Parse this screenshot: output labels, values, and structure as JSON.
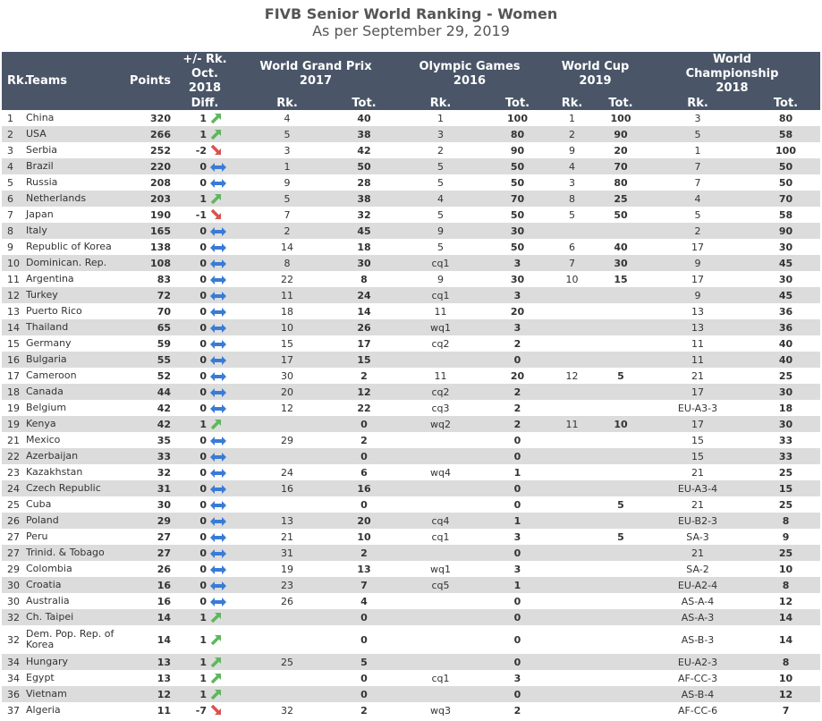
{
  "title": "FIVB Senior World Ranking - Women",
  "subtitle": "As per September 29, 2019",
  "headers": {
    "rk": "Rk.",
    "teams": "Teams",
    "points": "Points",
    "diff_top": "+/- Rk. Oct. 2018",
    "diff_bottom": "Diff.",
    "wgp": "World Grand Prix 2017",
    "og": "Olympic Games 2016",
    "wc": "World Cup 2019",
    "wch": "World Championship 2018",
    "sub_rk": "Rk.",
    "sub_tot": "Tot."
  },
  "colors": {
    "header_bg": "#4a5568",
    "up": "#5cb85c",
    "down": "#d9534f",
    "same": "#3a7bd5"
  },
  "rows": [
    {
      "rk": "1",
      "team": "China",
      "points": "320",
      "diff": "1",
      "trend": "up",
      "gpr": "4",
      "gpt": "40",
      "ogr": "1",
      "ogt": "100",
      "wcr": "1",
      "wct": "100",
      "chr": "3",
      "cht": "80"
    },
    {
      "rk": "2",
      "team": "USA",
      "points": "266",
      "diff": "1",
      "trend": "up",
      "gpr": "5",
      "gpt": "38",
      "ogr": "3",
      "ogt": "80",
      "wcr": "2",
      "wct": "90",
      "chr": "5",
      "cht": "58"
    },
    {
      "rk": "3",
      "team": "Serbia",
      "points": "252",
      "diff": "-2",
      "trend": "down",
      "gpr": "3",
      "gpt": "42",
      "ogr": "2",
      "ogt": "90",
      "wcr": "9",
      "wct": "20",
      "chr": "1",
      "cht": "100"
    },
    {
      "rk": "4",
      "team": "Brazil",
      "points": "220",
      "diff": "0",
      "trend": "same",
      "gpr": "1",
      "gpt": "50",
      "ogr": "5",
      "ogt": "50",
      "wcr": "4",
      "wct": "70",
      "chr": "7",
      "cht": "50"
    },
    {
      "rk": "5",
      "team": "Russia",
      "points": "208",
      "diff": "0",
      "trend": "same",
      "gpr": "9",
      "gpt": "28",
      "ogr": "5",
      "ogt": "50",
      "wcr": "3",
      "wct": "80",
      "chr": "7",
      "cht": "50"
    },
    {
      "rk": "6",
      "team": "Netherlands",
      "points": "203",
      "diff": "1",
      "trend": "up",
      "gpr": "5",
      "gpt": "38",
      "ogr": "4",
      "ogt": "70",
      "wcr": "8",
      "wct": "25",
      "chr": "4",
      "cht": "70"
    },
    {
      "rk": "7",
      "team": "Japan",
      "points": "190",
      "diff": "-1",
      "trend": "down",
      "gpr": "7",
      "gpt": "32",
      "ogr": "5",
      "ogt": "50",
      "wcr": "5",
      "wct": "50",
      "chr": "5",
      "cht": "58"
    },
    {
      "rk": "8",
      "team": "Italy",
      "points": "165",
      "diff": "0",
      "trend": "same",
      "gpr": "2",
      "gpt": "45",
      "ogr": "9",
      "ogt": "30",
      "wcr": "",
      "wct": "",
      "chr": "2",
      "cht": "90"
    },
    {
      "rk": "9",
      "team": "Republic of Korea",
      "points": "138",
      "diff": "0",
      "trend": "same",
      "gpr": "14",
      "gpt": "18",
      "ogr": "5",
      "ogt": "50",
      "wcr": "6",
      "wct": "40",
      "chr": "17",
      "cht": "30"
    },
    {
      "rk": "10",
      "team": "Dominican. Rep.",
      "points": "108",
      "diff": "0",
      "trend": "same",
      "gpr": "8",
      "gpt": "30",
      "ogr": "cq1",
      "ogt": "3",
      "wcr": "7",
      "wct": "30",
      "chr": "9",
      "cht": "45"
    },
    {
      "rk": "11",
      "team": "Argentina",
      "points": "83",
      "diff": "0",
      "trend": "same",
      "gpr": "22",
      "gpt": "8",
      "ogr": "9",
      "ogt": "30",
      "wcr": "10",
      "wct": "15",
      "chr": "17",
      "cht": "30"
    },
    {
      "rk": "12",
      "team": "Turkey",
      "points": "72",
      "diff": "0",
      "trend": "same",
      "gpr": "11",
      "gpt": "24",
      "ogr": "cq1",
      "ogt": "3",
      "wcr": "",
      "wct": "",
      "chr": "9",
      "cht": "45"
    },
    {
      "rk": "13",
      "team": "Puerto Rico",
      "points": "70",
      "diff": "0",
      "trend": "same",
      "gpr": "18",
      "gpt": "14",
      "ogr": "11",
      "ogt": "20",
      "wcr": "",
      "wct": "",
      "chr": "13",
      "cht": "36"
    },
    {
      "rk": "14",
      "team": "Thailand",
      "points": "65",
      "diff": "0",
      "trend": "same",
      "gpr": "10",
      "gpt": "26",
      "ogr": "wq1",
      "ogt": "3",
      "wcr": "",
      "wct": "",
      "chr": "13",
      "cht": "36"
    },
    {
      "rk": "15",
      "team": "Germany",
      "points": "59",
      "diff": "0",
      "trend": "same",
      "gpr": "15",
      "gpt": "17",
      "ogr": "cq2",
      "ogt": "2",
      "wcr": "",
      "wct": "",
      "chr": "11",
      "cht": "40"
    },
    {
      "rk": "16",
      "team": "Bulgaria",
      "points": "55",
      "diff": "0",
      "trend": "same",
      "gpr": "17",
      "gpt": "15",
      "ogr": "",
      "ogt": "0",
      "wcr": "",
      "wct": "",
      "chr": "11",
      "cht": "40"
    },
    {
      "rk": "17",
      "team": "Cameroon",
      "points": "52",
      "diff": "0",
      "trend": "same",
      "gpr": "30",
      "gpt": "2",
      "ogr": "11",
      "ogt": "20",
      "wcr": "12",
      "wct": "5",
      "chr": "21",
      "cht": "25"
    },
    {
      "rk": "18",
      "team": "Canada",
      "points": "44",
      "diff": "0",
      "trend": "same",
      "gpr": "20",
      "gpt": "12",
      "ogr": "cq2",
      "ogt": "2",
      "wcr": "",
      "wct": "",
      "chr": "17",
      "cht": "30"
    },
    {
      "rk": "19",
      "team": "Belgium",
      "points": "42",
      "diff": "0",
      "trend": "same",
      "gpr": "12",
      "gpt": "22",
      "ogr": "cq3",
      "ogt": "2",
      "wcr": "",
      "wct": "",
      "chr": "EU-A3-3",
      "cht": "18"
    },
    {
      "rk": "19",
      "team": "Kenya",
      "points": "42",
      "diff": "1",
      "trend": "up",
      "gpr": "",
      "gpt": "0",
      "ogr": "wq2",
      "ogt": "2",
      "wcr": "11",
      "wct": "10",
      "chr": "17",
      "cht": "30"
    },
    {
      "rk": "21",
      "team": "Mexico",
      "points": "35",
      "diff": "0",
      "trend": "same",
      "gpr": "29",
      "gpt": "2",
      "ogr": "",
      "ogt": "0",
      "wcr": "",
      "wct": "",
      "chr": "15",
      "cht": "33"
    },
    {
      "rk": "22",
      "team": "Azerbaijan",
      "points": "33",
      "diff": "0",
      "trend": "same",
      "gpr": "",
      "gpt": "0",
      "ogr": "",
      "ogt": "0",
      "wcr": "",
      "wct": "",
      "chr": "15",
      "cht": "33"
    },
    {
      "rk": "23",
      "team": "Kazakhstan",
      "points": "32",
      "diff": "0",
      "trend": "same",
      "gpr": "24",
      "gpt": "6",
      "ogr": "wq4",
      "ogt": "1",
      "wcr": "",
      "wct": "",
      "chr": "21",
      "cht": "25"
    },
    {
      "rk": "24",
      "team": "Czech Republic",
      "points": "31",
      "diff": "0",
      "trend": "same",
      "gpr": "16",
      "gpt": "16",
      "ogr": "",
      "ogt": "0",
      "wcr": "",
      "wct": "",
      "chr": "EU-A3-4",
      "cht": "15"
    },
    {
      "rk": "25",
      "team": "Cuba",
      "points": "30",
      "diff": "0",
      "trend": "same",
      "gpr": "",
      "gpt": "0",
      "ogr": "",
      "ogt": "0",
      "wcr": "",
      "wct": "5",
      "chr": "21",
      "cht": "25"
    },
    {
      "rk": "26",
      "team": "Poland",
      "points": "29",
      "diff": "0",
      "trend": "same",
      "gpr": "13",
      "gpt": "20",
      "ogr": "cq4",
      "ogt": "1",
      "wcr": "",
      "wct": "",
      "chr": "EU-B2-3",
      "cht": "8"
    },
    {
      "rk": "27",
      "team": "Peru",
      "points": "27",
      "diff": "0",
      "trend": "same",
      "gpr": "21",
      "gpt": "10",
      "ogr": "cq1",
      "ogt": "3",
      "wcr": "",
      "wct": "5",
      "chr": "SA-3",
      "cht": "9"
    },
    {
      "rk": "27",
      "team": "Trinid. & Tobago",
      "points": "27",
      "diff": "0",
      "trend": "same",
      "gpr": "31",
      "gpt": "2",
      "ogr": "",
      "ogt": "0",
      "wcr": "",
      "wct": "",
      "chr": "21",
      "cht": "25"
    },
    {
      "rk": "29",
      "team": "Colombia",
      "points": "26",
      "diff": "0",
      "trend": "same",
      "gpr": "19",
      "gpt": "13",
      "ogr": "wq1",
      "ogt": "3",
      "wcr": "",
      "wct": "",
      "chr": "SA-2",
      "cht": "10"
    },
    {
      "rk": "30",
      "team": "Croatia",
      "points": "16",
      "diff": "0",
      "trend": "same",
      "gpr": "23",
      "gpt": "7",
      "ogr": "cq5",
      "ogt": "1",
      "wcr": "",
      "wct": "",
      "chr": "EU-A2-4",
      "cht": "8"
    },
    {
      "rk": "30",
      "team": "Australia",
      "points": "16",
      "diff": "0",
      "trend": "same",
      "gpr": "26",
      "gpt": "4",
      "ogr": "",
      "ogt": "0",
      "wcr": "",
      "wct": "",
      "chr": "AS-A-4",
      "cht": "12"
    },
    {
      "rk": "32",
      "team": "Ch. Taipei",
      "points": "14",
      "diff": "1",
      "trend": "up",
      "gpr": "",
      "gpt": "0",
      "ogr": "",
      "ogt": "0",
      "wcr": "",
      "wct": "",
      "chr": "AS-A-3",
      "cht": "14"
    },
    {
      "rk": "32",
      "team": "Dem. Pop. Rep. of Korea",
      "points": "14",
      "diff": "1",
      "trend": "up",
      "gpr": "",
      "gpt": "0",
      "ogr": "",
      "ogt": "0",
      "wcr": "",
      "wct": "",
      "chr": "AS-B-3",
      "cht": "14",
      "tall": true
    },
    {
      "rk": "34",
      "team": "Hungary",
      "points": "13",
      "diff": "1",
      "trend": "up",
      "gpr": "25",
      "gpt": "5",
      "ogr": "",
      "ogt": "0",
      "wcr": "",
      "wct": "",
      "chr": "EU-A2-3",
      "cht": "8"
    },
    {
      "rk": "34",
      "team": "Egypt",
      "points": "13",
      "diff": "1",
      "trend": "up",
      "gpr": "",
      "gpt": "0",
      "ogr": "cq1",
      "ogt": "3",
      "wcr": "",
      "wct": "",
      "chr": "AF-CC-3",
      "cht": "10"
    },
    {
      "rk": "36",
      "team": "Vietnam",
      "points": "12",
      "diff": "1",
      "trend": "up",
      "gpr": "",
      "gpt": "0",
      "ogr": "",
      "ogt": "0",
      "wcr": "",
      "wct": "",
      "chr": "AS-B-4",
      "cht": "12"
    },
    {
      "rk": "37",
      "team": "Algeria",
      "points": "11",
      "diff": "-7",
      "trend": "down",
      "gpr": "32",
      "gpt": "2",
      "ogr": "wq3",
      "ogt": "2",
      "wcr": "",
      "wct": "",
      "chr": "AF-CC-6",
      "cht": "7"
    }
  ]
}
